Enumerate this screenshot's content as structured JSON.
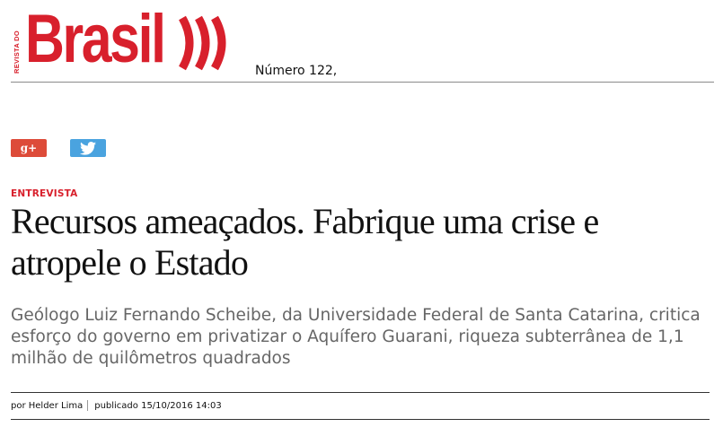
{
  "masthead": {
    "logo_side_text": "REVISTA DO",
    "logo_word": "Brasil",
    "issue_label": "Número 122,"
  },
  "share": {
    "gplus_label": "g+",
    "gplus_icon": "google-plus-icon",
    "twitter_icon": "twitter-bird-icon"
  },
  "article": {
    "kicker": "ENTREVISTA",
    "headline": "Recursos ameaçados. Fabrique uma crise e atropele o Estado",
    "subhead": "Geólogo Luiz Fernando Scheibe, da Universidade Federal de Santa Catarina, critica esforço do governo em privatizar o Aquífero Guarani, riqueza subterrânea de 1,1 milhão de quilômetros quadrados",
    "byline_author": "por Helder Lima",
    "byline_published": "publicado 15/10/2016 14:03"
  },
  "colors": {
    "brand_red": "#d8202c",
    "gplus_red": "#dd4b39",
    "twitter_blue": "#4aa3df",
    "subhead_gray": "#666666"
  }
}
